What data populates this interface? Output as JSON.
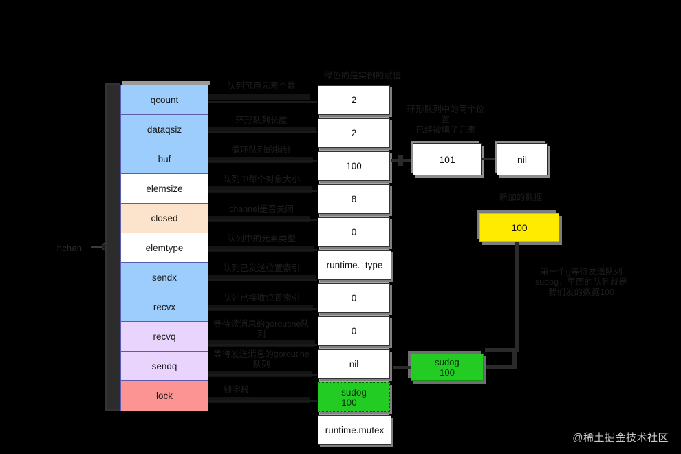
{
  "diagram": {
    "title_struct_values": "绿色的是实例的赋值",
    "root_label": "hchan",
    "watermark": "@稀土掘金技术社区"
  },
  "fields": [
    {
      "name": "qcount",
      "color": "#9ccdfc",
      "annotation": "队列可用元素个数",
      "value": "2"
    },
    {
      "name": "dataqsiz",
      "color": "#9ccdfc",
      "annotation": "环形队列长度",
      "value": "2"
    },
    {
      "name": "buf",
      "color": "#9ccdfc",
      "annotation": "循环队列的指针",
      "value": "100"
    },
    {
      "name": "elemsize",
      "color": "#ffffff",
      "annotation": "队列中每个对象大小",
      "value": "8"
    },
    {
      "name": "closed",
      "color": "#fce4cc",
      "annotation": "channel是否关闭",
      "value": "0"
    },
    {
      "name": "elemtype",
      "color": "#ffffff",
      "annotation": "队列中的元素类型",
      "value": "runtime._type"
    },
    {
      "name": "sendx",
      "color": "#9ccdfc",
      "annotation": "队列已发送位置索引",
      "value": "0"
    },
    {
      "name": "recvx",
      "color": "#9ccdfc",
      "annotation": "队列已接收位置索引",
      "value": "0"
    },
    {
      "name": "recvq",
      "color": "#e8d4fc",
      "annotation": "等待读消息的goroutine队列",
      "value": "nil"
    },
    {
      "name": "sendq",
      "color": "#e8d4fc",
      "annotation": "等待发送消息的goroutine队列",
      "value": "sudog\n100"
    },
    {
      "name": "lock",
      "color": "#fc9494",
      "annotation": "锁字段",
      "value": "runtime.mutex"
    }
  ],
  "ring_buffer": {
    "note": "环形队列中的两个位置\n已经被填了元素",
    "slot_1": "101",
    "slot_2": "nil"
  },
  "new_data": {
    "note": "新加的数据",
    "value": "100"
  },
  "sudog": {
    "label": "sudog",
    "value": "100",
    "note": "第一个g等待发送队列\nsudog，里面的队列就是\n我们发的数据100"
  },
  "colors": {
    "blue": "#9ccdfc",
    "peach": "#fce4cc",
    "purple": "#e8d4fc",
    "red": "#fc9494",
    "yellow": "#ffeb00",
    "green": "#22cc22",
    "background": "#000000"
  }
}
